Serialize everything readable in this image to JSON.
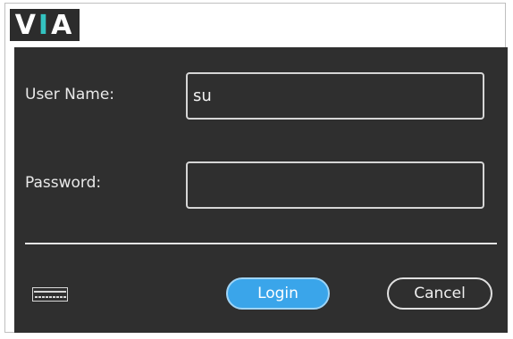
{
  "logo": {
    "text_left": "V",
    "text_accent": "I",
    "text_right": "A"
  },
  "form": {
    "username_label": "User Name:",
    "username_value": "su",
    "password_label": "Password:",
    "password_value": ""
  },
  "footer": {
    "keyboard_icon": "keyboard-icon",
    "login_label": "Login",
    "cancel_label": "Cancel"
  },
  "colors": {
    "panel_bg": "#2f2f2f",
    "logo_accent": "#33c3c0",
    "login_button": "#3aa5ea"
  }
}
